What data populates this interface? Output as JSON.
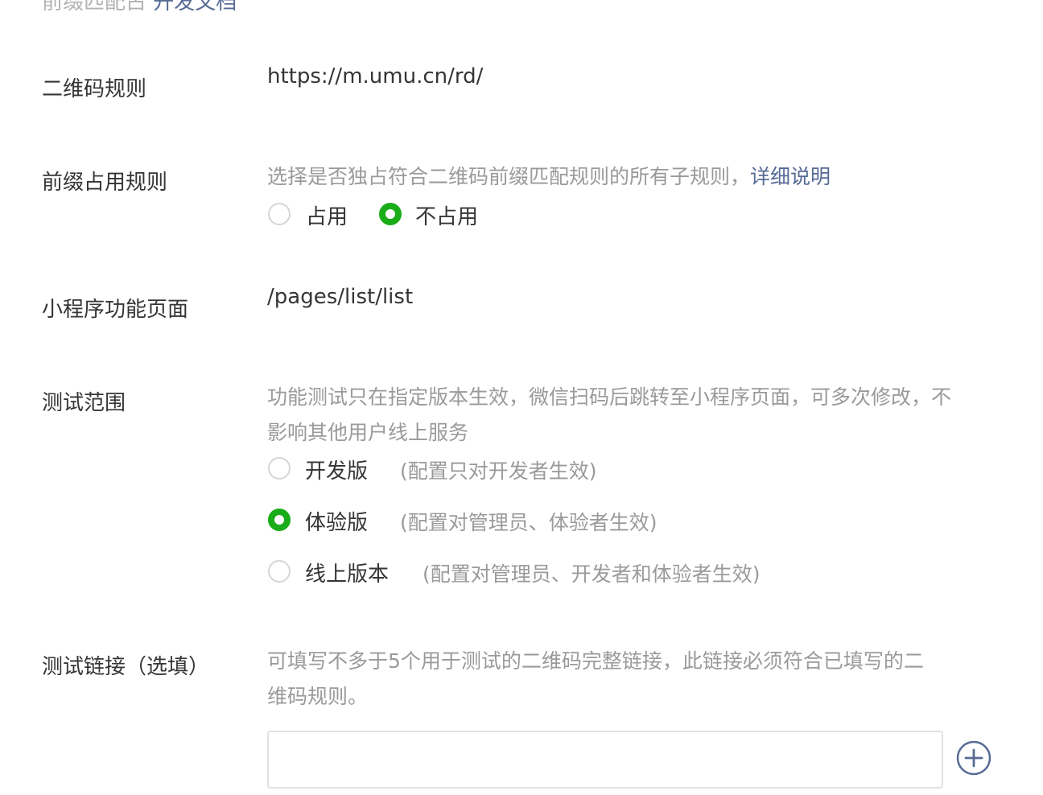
{
  "top_partial": {
    "text": "前缀匹配占 ",
    "link": "开发文档"
  },
  "qrcode_rule": {
    "label": "二维码规则",
    "value": "https://m.umu.cn/rd/"
  },
  "prefix_rule": {
    "label": "前缀占用规则",
    "desc": "选择是否独占符合二维码前缀匹配规则的所有子规则，",
    "link": "详细说明",
    "options": [
      {
        "label": "占用",
        "checked": false
      },
      {
        "label": "不占用",
        "checked": true
      }
    ]
  },
  "page_path": {
    "label": "小程序功能页面",
    "value": "/pages/list/list"
  },
  "test_scope": {
    "label": "测试范围",
    "desc": "功能测试只在指定版本生效，微信扫码后跳转至小程序页面，可多次修改，不影响其他用户线上服务",
    "options": [
      {
        "label": "开发版",
        "note": "(配置只对开发者生效)",
        "checked": false
      },
      {
        "label": "体验版",
        "note": "(配置对管理员、体验者生效)",
        "checked": true
      },
      {
        "label": "线上版本",
        "note": "(配置对管理员、开发者和体验者生效)",
        "checked": false
      }
    ]
  },
  "test_link": {
    "label": "测试链接（选填）",
    "desc": "可填写不多于5个用于测试的二维码完整链接，此链接必须符合已填写的二维码规则。",
    "input_value": "",
    "add_icon": "plus-circle-icon"
  },
  "colors": {
    "accent": "#1aad19",
    "link": "#576b95",
    "muted": "#9a9a9a",
    "text": "#353535"
  }
}
